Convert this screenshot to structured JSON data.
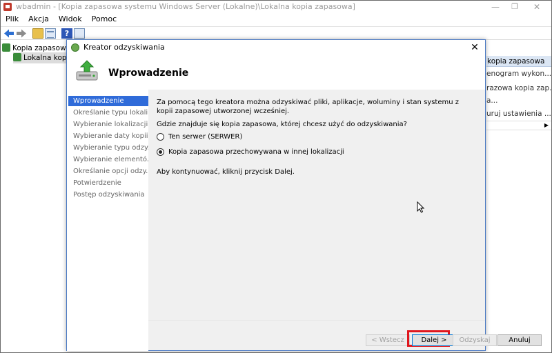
{
  "window": {
    "title": "wbadmin - [Kopia zapasowa systemu Windows Server (Lokalne)\\Lokalna kopia zapasowa]",
    "controls": {
      "minimize": "—",
      "maximize": "❐",
      "close": "✕"
    }
  },
  "menu": [
    "Plik",
    "Akcja",
    "Widok",
    "Pomoc"
  ],
  "toolbar": {
    "help_glyph": "?"
  },
  "tree": {
    "root": "Kopia zapasowa sy",
    "child": "Lokalna kopia"
  },
  "actions": {
    "header": "kopia zapasowa",
    "items": [
      "enogram wykon...",
      "razowa kopia zap...",
      "a...",
      "uruj ustawienia ..."
    ]
  },
  "dialog": {
    "title": "Kreator odzyskiwania",
    "close_glyph": "✕",
    "heading": "Wprowadzenie",
    "nav": [
      "Wprowadzenie",
      "Określanie typu lokali...",
      "Wybieranie lokalizacji...",
      "Wybieranie daty kopii...",
      "Wybieranie typu odzy...",
      "Wybieranie elementó...",
      "Określanie opcji odzy...",
      "Potwierdzenie",
      "Postęp odzyskiwania"
    ],
    "intro": "Za pomocą tego kreatora można odzyskiwać pliki, aplikacje, woluminy i stan systemu z kopii zapasowej utworzonej wcześniej.",
    "question": "Gdzie znajduje się kopia zapasowa, której chcesz użyć do odzyskiwania?",
    "options": [
      {
        "label": "Ten serwer (SERWER)",
        "checked": false
      },
      {
        "label": "Kopia zapasowa przechowywana w innej lokalizacji",
        "checked": true
      }
    ],
    "continue_text": "Aby kontynuować, kliknij przycisk Dalej.",
    "buttons": {
      "back": "< Wstecz",
      "next": "Dalej >",
      "restore": "Odzyskaj",
      "cancel": "Anuluj"
    }
  }
}
